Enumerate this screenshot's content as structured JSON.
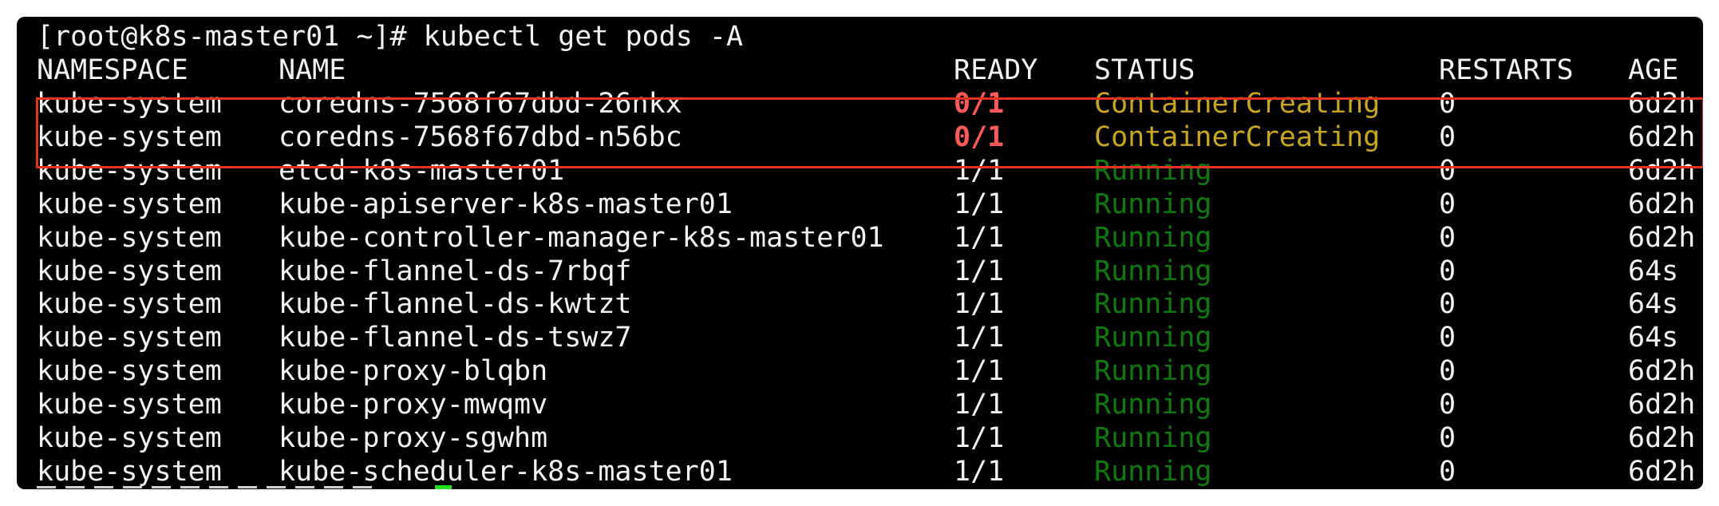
{
  "prompt_line": "[root@k8s-master01 ~]# kubectl get pods -A",
  "headers": {
    "namespace": "NAMESPACE",
    "name": "NAME",
    "ready": "READY",
    "status": "STATUS",
    "restarts": "RESTARTS",
    "age": "AGE"
  },
  "rows": [
    {
      "namespace": "kube-system",
      "name": "coredns-7568f67dbd-26nkx",
      "ready": "0/1",
      "status": "ContainerCreating",
      "restarts": "0",
      "age": "6d2h"
    },
    {
      "namespace": "kube-system",
      "name": "coredns-7568f67dbd-n56bc",
      "ready": "0/1",
      "status": "ContainerCreating",
      "restarts": "0",
      "age": "6d2h"
    },
    {
      "namespace": "kube-system",
      "name": "etcd-k8s-master01",
      "ready": "1/1",
      "status": "Running",
      "restarts": "0",
      "age": "6d2h"
    },
    {
      "namespace": "kube-system",
      "name": "kube-apiserver-k8s-master01",
      "ready": "1/1",
      "status": "Running",
      "restarts": "0",
      "age": "6d2h"
    },
    {
      "namespace": "kube-system",
      "name": "kube-controller-manager-k8s-master01",
      "ready": "1/1",
      "status": "Running",
      "restarts": "0",
      "age": "6d2h"
    },
    {
      "namespace": "kube-system",
      "name": "kube-flannel-ds-7rbqf",
      "ready": "1/1",
      "status": "Running",
      "restarts": "0",
      "age": "64s"
    },
    {
      "namespace": "kube-system",
      "name": "kube-flannel-ds-kwtzt",
      "ready": "1/1",
      "status": "Running",
      "restarts": "0",
      "age": "64s"
    },
    {
      "namespace": "kube-system",
      "name": "kube-flannel-ds-tswz7",
      "ready": "1/1",
      "status": "Running",
      "restarts": "0",
      "age": "64s"
    },
    {
      "namespace": "kube-system",
      "name": "kube-proxy-blqbn",
      "ready": "1/1",
      "status": "Running",
      "restarts": "0",
      "age": "6d2h"
    },
    {
      "namespace": "kube-system",
      "name": "kube-proxy-mwqmv",
      "ready": "1/1",
      "status": "Running",
      "restarts": "0",
      "age": "6d2h"
    },
    {
      "namespace": "kube-system",
      "name": "kube-proxy-sgwhm",
      "ready": "1/1",
      "status": "Running",
      "restarts": "0",
      "age": "6d2h"
    },
    {
      "namespace": "kube-system",
      "name": "kube-scheduler-k8s-master01",
      "ready": "1/1",
      "status": "Running",
      "restarts": "0",
      "age": "6d2h"
    }
  ],
  "colors": {
    "background": "#000000",
    "text": "#f2f2f2",
    "ready_not": "#ff5a5a",
    "status_creating": "#c8a620",
    "status_running": "#0f7a0f",
    "highlight_border": "#e5321f",
    "cursor": "#20e020"
  }
}
